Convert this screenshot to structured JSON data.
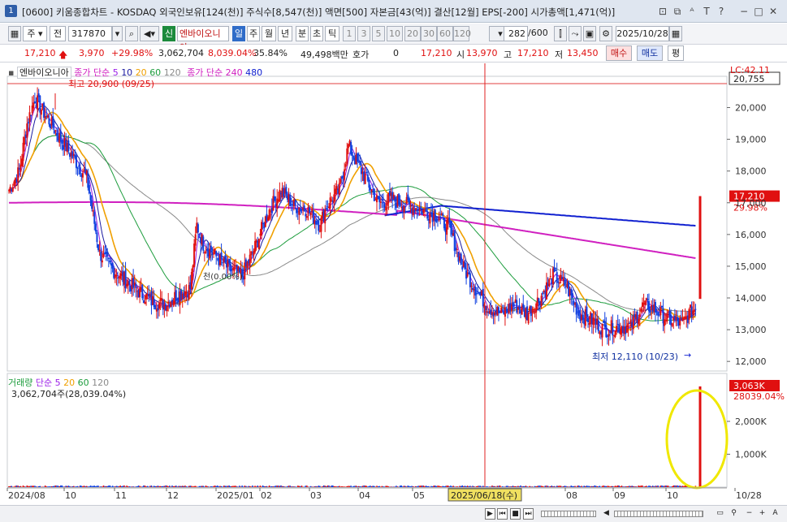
{
  "window": {
    "icon_label": "1",
    "title": "[0600] 키움종합차트 - KOSDAQ 외국인보유[124(천)] 주식수[8,547(천)] 액면[500] 자본금[43(억)] 결산[12월] EPS[-200] 시가총액[1,471(억)]"
  },
  "toolbar": {
    "period_label": "주",
    "prev_label": "전",
    "code": "317870",
    "badge": "신",
    "stock_name": "엔바이오니아",
    "periods": [
      "일",
      "주",
      "월",
      "년",
      "분",
      "초",
      "틱"
    ],
    "numbers": [
      "1",
      "3",
      "5",
      "10",
      "20",
      "30",
      "60",
      "120"
    ],
    "count": "282",
    "total": "/600",
    "date": "2025/10/28"
  },
  "quote": {
    "price": "17,210",
    "change": "3,970",
    "change_pct": "+29.98%",
    "volume": "3,062,704",
    "volume_pct": "8,039.04%",
    "turnover": "35.84%",
    "amount": "49,498백만",
    "hoga_label": "호가",
    "hoga_value": "0",
    "hoga_price": "17,210",
    "open_label": "시",
    "open": "13,970",
    "high_label": "고",
    "high": "17,210",
    "low_label": "저",
    "low": "13,450",
    "buy_label": "매수",
    "sell_label": "매도",
    "eval_label": "평"
  },
  "price_panel": {
    "name": "엔바이오니아",
    "legend_ma": "종가 단순",
    "ma_periods": [
      "5",
      "10",
      "20",
      "60",
      "120"
    ],
    "legend_ma2": "종가 단순",
    "ma2_periods": [
      "240",
      "480"
    ],
    "high_note": "최고 20,900 (09/25)",
    "low_note": "최저 12,110 (10/23)",
    "mid_note": "천(0.00%)",
    "lc_label": "LC:42.11",
    "cursor_price": "20,755",
    "last_price": "17,210",
    "last_pct": "29.98%",
    "y_ticks": [
      "20,000",
      "19,000",
      "18,000",
      "17,000",
      "16,000",
      "15,000",
      "14,000",
      "13,000",
      "12,000"
    ]
  },
  "volume_panel": {
    "legend": "거래량",
    "ma_label": "단순",
    "ma_periods": [
      "5",
      "20",
      "60",
      "120"
    ],
    "value": "3,062,704주(28,039.04%)",
    "last_label": "3,063K",
    "last_pct": "28039.04%",
    "y_ticks": [
      "2,000K",
      "1,000K"
    ]
  },
  "x_axis": {
    "labels": [
      "2024/08",
      "10",
      "11",
      "12",
      "2025/01",
      "02",
      "03",
      "04",
      "05",
      "08",
      "09",
      "10",
      "10/28"
    ],
    "cursor_label": "2025/06/18(수)"
  },
  "colors": {
    "up": "#e01010",
    "down": "#1040e0",
    "ma5": "#9b1fe8",
    "ma10": "#1a1aa0",
    "ma20": "#f0a000",
    "ma60": "#1c9c3c",
    "ma120": "#8a8a8a",
    "ma240": "#d020c0",
    "ma480": "#1020d0",
    "highlight": "#f0e800"
  }
}
